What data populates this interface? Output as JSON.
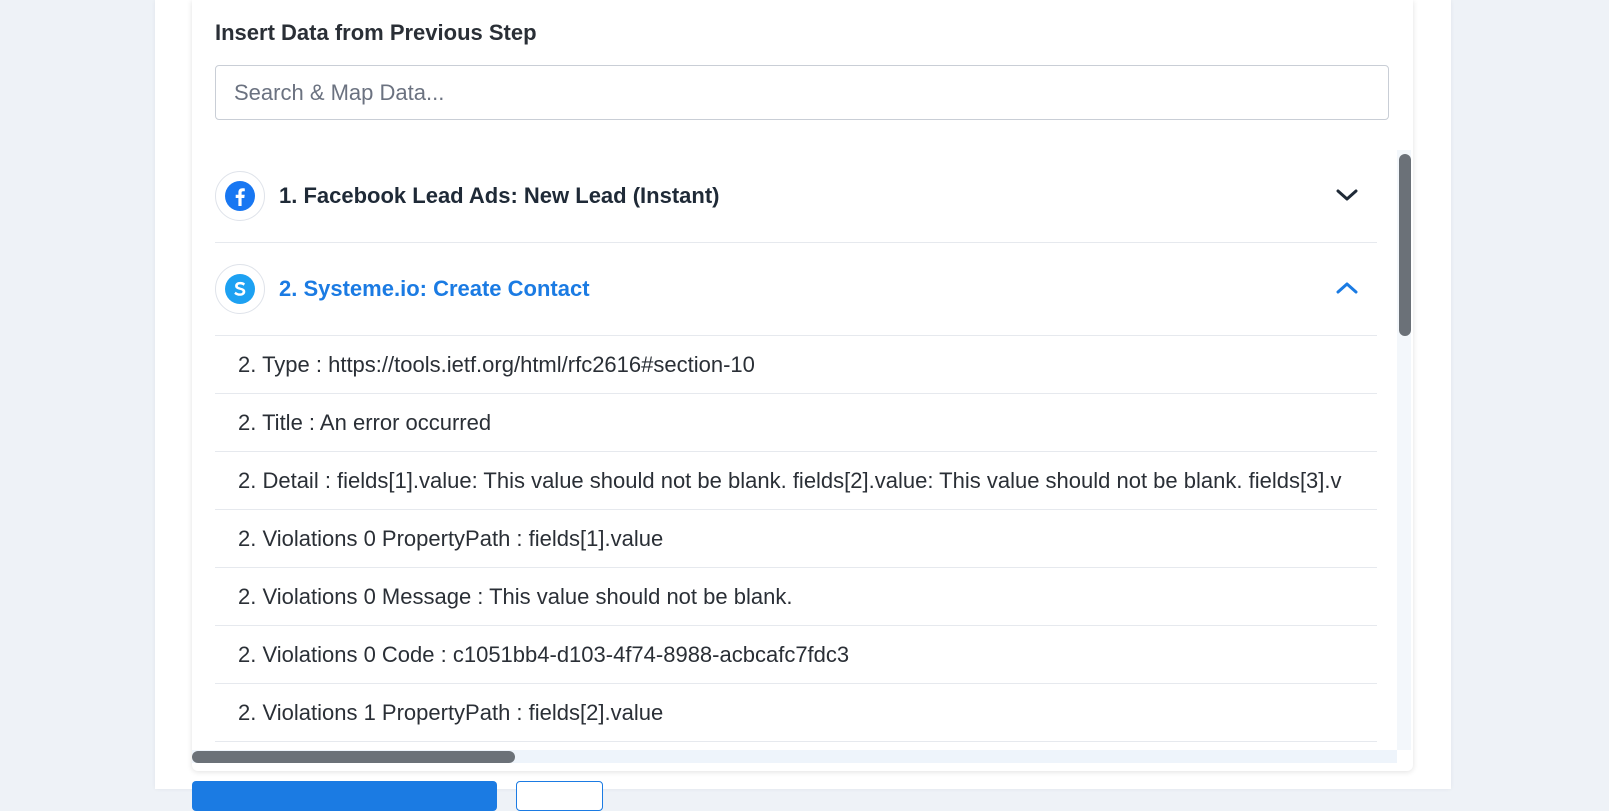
{
  "panel": {
    "title": "Insert Data from Previous Step",
    "search_placeholder": "Search & Map Data..."
  },
  "steps": [
    {
      "label": "1. Facebook Lead Ads: New Lead (Instant)",
      "icon": "facebook-icon",
      "expanded": false
    },
    {
      "label": "2. Systeme.io: Create Contact",
      "icon": "systeme-icon",
      "expanded": true
    }
  ],
  "rows": [
    "2. Type : https://tools.ietf.org/html/rfc2616#section-10",
    "2. Title : An error occurred",
    "2. Detail : fields[1].value: This value should not be blank. fields[2].value: This value should not be blank. fields[3].v",
    "2. Violations 0 PropertyPath : fields[1].value",
    "2. Violations 0 Message : This value should not be blank.",
    "2. Violations 0 Code : c1051bb4-d103-4f74-8988-acbcafc7fdc3",
    "2. Violations 1 PropertyPath : fields[2].value"
  ],
  "colors": {
    "accent": "#1b7be3",
    "facebook": "#1877f2",
    "systeme": "#1da1f2"
  }
}
